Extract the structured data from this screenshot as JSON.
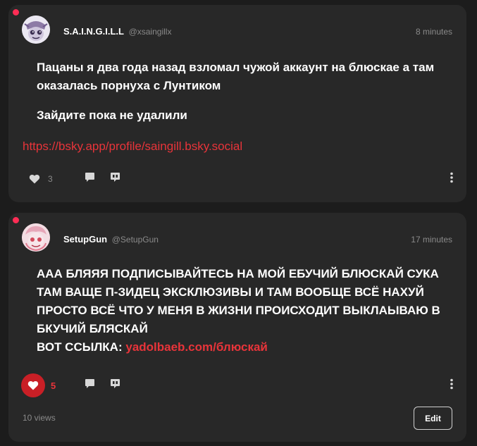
{
  "posts": [
    {
      "author": {
        "display_name": "S.A.I.N.G.I.L.L",
        "handle": "@xsaingillx"
      },
      "time": "8 minutes",
      "paragraphs": [
        "Пацаны я два года назад взломал чужой аккаунт на блюскае а там оказалась порнуха с Лунтиком",
        "Зайдите пока не удалили"
      ],
      "link": "https://bsky.app/profile/saingill.bsky.social",
      "likes": "3",
      "unread": true
    },
    {
      "author": {
        "display_name": "SetupGun",
        "handle": "@SetupGun"
      },
      "time": "17 minutes",
      "text": "ААА БЛЯЯЯ ПОДПИСЫВАЙТЕСЬ НА МОЙ ЕБУЧИЙ БЛЮСКАЙ СУКА ТАМ ВАЩЕ П-ЗИДЕЦ ЭКСКЛЮЗИВЫ И ТАМ ВООБЩЕ ВСЁ НАХУЙ ПРОСТО ВСЁ ЧТО У МЕНЯ В ЖИЗНИ ПРОИСХОДИТ ВЫКЛАЫВАЮ В БКУЧИЙ БЛЯСКАЙ",
      "link_prefix": "ВОТ ССЫЛКА: ",
      "link": "yadolbaeb.com/блюскай",
      "likes": "5",
      "liked": true,
      "views": "10 views",
      "edit_label": "Edit",
      "unread": true
    }
  ],
  "icons": {
    "like": "heart-icon",
    "reply": "speech-bubble-icon",
    "repost": "quote-icon",
    "more": "vertical-dots-icon"
  },
  "colors": {
    "background": "#1c1c1c",
    "card": "#282828",
    "accent": "#e8343a",
    "like_active": "#c91f26",
    "unread_dot": "#ff2d55",
    "muted_text": "#8a8a8a"
  }
}
